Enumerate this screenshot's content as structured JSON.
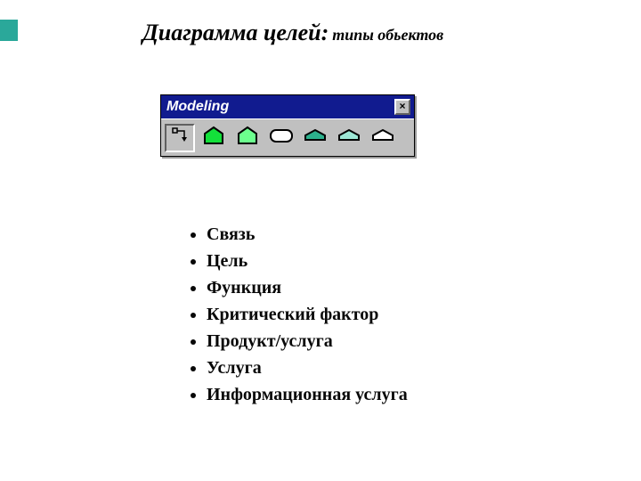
{
  "heading": {
    "main": "Диаграмма целей:",
    "sub": "типы обьектов"
  },
  "window": {
    "title": "Modeling",
    "close_label": "×"
  },
  "toolbar": {
    "buttons": [
      {
        "name": "link-tool",
        "icon": "link-icon",
        "fill": "#ffffff",
        "shape": "link",
        "pressed": true
      },
      {
        "name": "goal-tool",
        "icon": "goal-icon",
        "fill": "#13e03a",
        "shape": "house",
        "pressed": false
      },
      {
        "name": "function-tool",
        "icon": "function-icon",
        "fill": "#6cff8e",
        "shape": "house",
        "pressed": false
      },
      {
        "name": "critical-factor-tool",
        "icon": "critical-factor-icon",
        "fill": "#ffffff",
        "shape": "rounded",
        "pressed": false
      },
      {
        "name": "product-service-tool",
        "icon": "product-service-icon",
        "fill": "#2cb08c",
        "shape": "flat",
        "pressed": false
      },
      {
        "name": "service-tool",
        "icon": "service-icon",
        "fill": "#9de7d5",
        "shape": "flat",
        "pressed": false
      },
      {
        "name": "info-service-tool",
        "icon": "info-service-icon",
        "fill": "#ffffff",
        "shape": "flat",
        "pressed": false
      }
    ]
  },
  "list": {
    "items": [
      "Связь",
      "Цель",
      "Функция",
      "Критический фактор",
      "Продукт/услуга",
      "Услуга",
      "Информационная услуга"
    ]
  }
}
